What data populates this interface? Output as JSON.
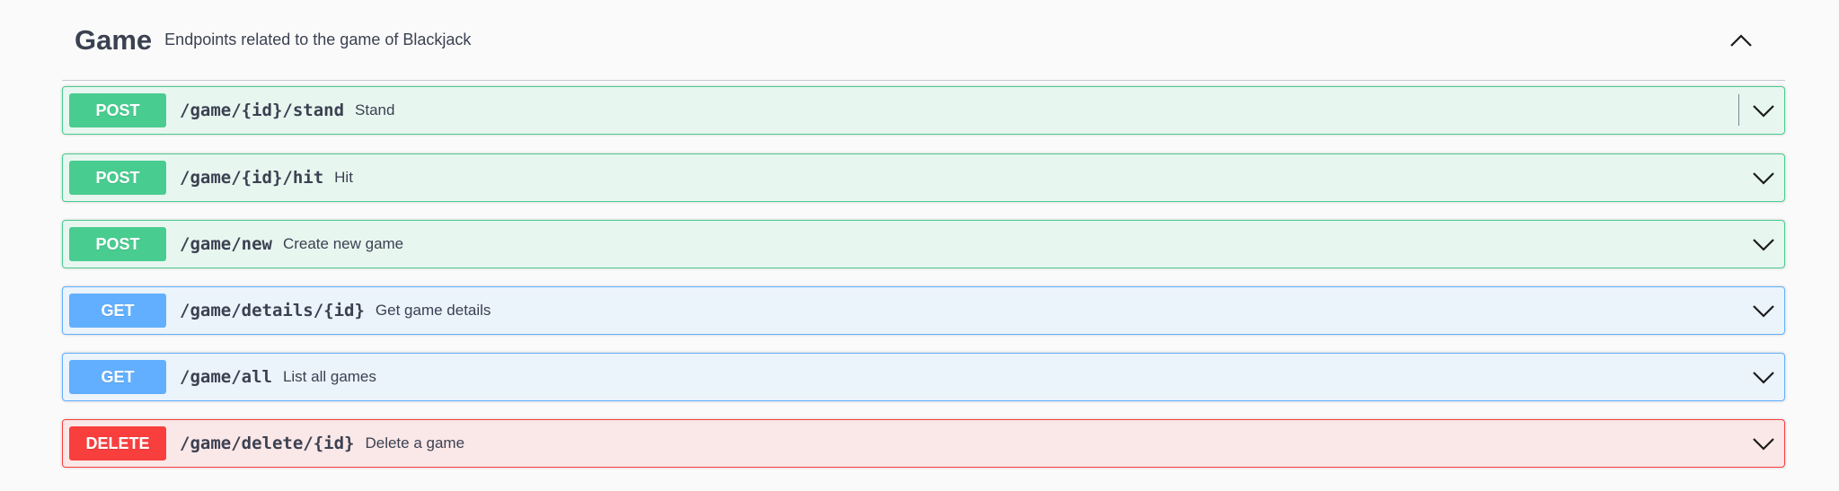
{
  "tag": {
    "title": "Game",
    "description": "Endpoints related to the game of Blackjack",
    "collapse_icon": "chevron-up-icon"
  },
  "operations": [
    {
      "method": "POST",
      "path": "/game/{id}/stand",
      "summary": "Stand",
      "color": "#49cc90"
    },
    {
      "method": "POST",
      "path": "/game/{id}/hit",
      "summary": "Hit",
      "color": "#49cc90"
    },
    {
      "method": "POST",
      "path": "/game/new",
      "summary": "Create new game",
      "color": "#49cc90"
    },
    {
      "method": "GET",
      "path": "/game/details/{id}",
      "summary": "Get game details",
      "color": "#61affe"
    },
    {
      "method": "GET",
      "path": "/game/all",
      "summary": "List all games",
      "color": "#61affe"
    },
    {
      "method": "DELETE",
      "path": "/game/delete/{id}",
      "summary": "Delete a game",
      "color": "#f93e3e"
    }
  ]
}
